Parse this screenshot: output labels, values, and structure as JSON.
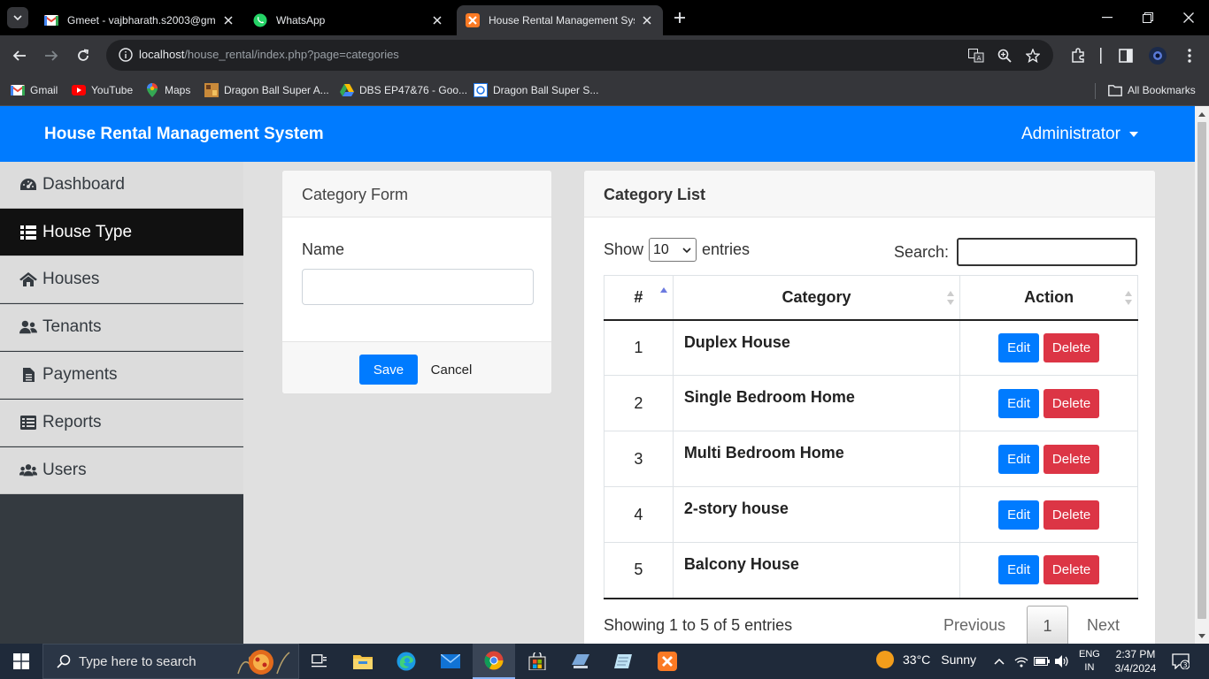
{
  "browser": {
    "tabs": [
      {
        "title": "Gmeet - vajbharath.s2003@gm",
        "icon": "gmail-icon",
        "active": false
      },
      {
        "title": "WhatsApp",
        "icon": "whatsapp-icon",
        "active": false
      },
      {
        "title": "House Rental Management Syst",
        "icon": "xampp-icon",
        "active": true
      }
    ],
    "url_host": "localhost",
    "url_path": "/house_rental/index.php?page=categories",
    "bookmarks": [
      {
        "label": "Gmail",
        "icon": "gmail-icon"
      },
      {
        "label": "YouTube",
        "icon": "youtube-icon"
      },
      {
        "label": "Maps",
        "icon": "maps-icon"
      },
      {
        "label": "Dragon Ball Super A...",
        "icon": "image-icon"
      },
      {
        "label": "DBS EP47&76 - Goo...",
        "icon": "drive-icon"
      },
      {
        "label": "Dragon Ball Super S...",
        "icon": "site-icon"
      }
    ],
    "all_bookmarks": "All Bookmarks"
  },
  "app": {
    "title": "House Rental Management System",
    "user_menu": "Administrator"
  },
  "sidebar": {
    "items": [
      {
        "label": "Dashboard",
        "icon": "dashboard-icon",
        "active": false
      },
      {
        "label": "House Type",
        "icon": "list-icon",
        "active": true
      },
      {
        "label": "Houses",
        "icon": "home-icon",
        "active": false
      },
      {
        "label": "Tenants",
        "icon": "users-icon",
        "active": false
      },
      {
        "label": "Payments",
        "icon": "file-icon",
        "active": false
      },
      {
        "label": "Reports",
        "icon": "table-icon",
        "active": false
      },
      {
        "label": "Users",
        "icon": "group-icon",
        "active": false
      }
    ]
  },
  "form": {
    "heading": "Category Form",
    "name_label": "Name",
    "name_value": "",
    "save_label": "Save",
    "cancel_label": "Cancel"
  },
  "list": {
    "heading": "Category List",
    "show_label": "Show",
    "page_size": "10",
    "entries_label": "entries",
    "search_label": "Search:",
    "search_value": "",
    "columns": [
      "#",
      "Category",
      "Action"
    ],
    "rows": [
      {
        "num": "1",
        "category": "Duplex House"
      },
      {
        "num": "2",
        "category": "Single Bedroom Home"
      },
      {
        "num": "3",
        "category": "Multi Bedroom Home"
      },
      {
        "num": "4",
        "category": "2-story house"
      },
      {
        "num": "5",
        "category": "Balcony House"
      }
    ],
    "edit_label": "Edit",
    "delete_label": "Delete",
    "info": "Showing 1 to 5 of 5 entries",
    "prev_label": "Previous",
    "current_page": "1",
    "next_label": "Next"
  },
  "taskbar": {
    "search_placeholder": "Type here to search",
    "weather_temp": "33°C",
    "weather_text": "Sunny",
    "lang_top": "ENG",
    "lang_bottom": "IN",
    "time": "2:37 PM",
    "date": "3/4/2024",
    "notifications": "3"
  },
  "colors": {
    "primary": "#007bff",
    "danger": "#dc3545",
    "sidebar_active": "#111111",
    "header_bg": "#007bff"
  }
}
